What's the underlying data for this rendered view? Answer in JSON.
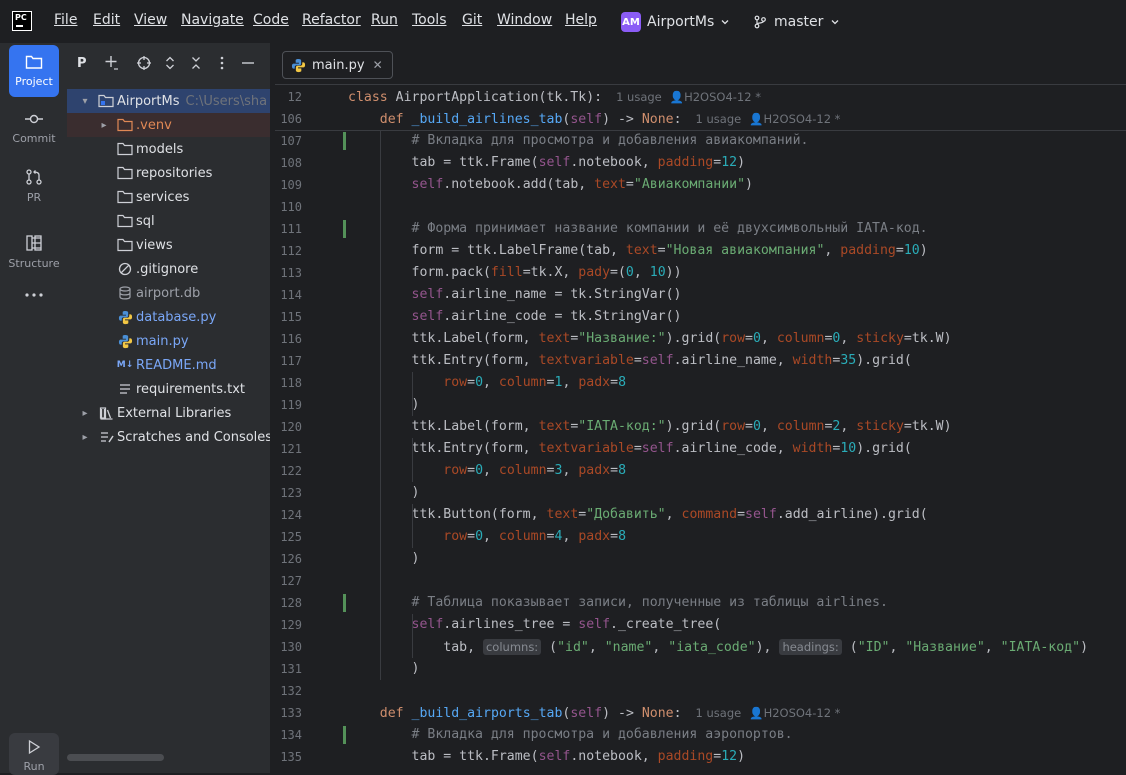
{
  "menubar": {
    "logo_text": "PC",
    "items": [
      "File",
      "Edit",
      "View",
      "Navigate",
      "Code",
      "Refactor",
      "Run",
      "Tools",
      "Git",
      "Window",
      "Help"
    ],
    "project_initials": "AM",
    "project_name": "AirportMs",
    "branch": "master",
    "colors": {
      "project_avatar": "#8b5cf6",
      "accent": "#3574f0"
    }
  },
  "toolwindows": [
    {
      "label": "Project",
      "icon": "folder-icon",
      "active": true
    },
    {
      "label": "Commit",
      "icon": "commit-icon",
      "active": false
    },
    {
      "label": "PR",
      "icon": "pull-request-icon",
      "active": false
    },
    {
      "label": "Structure",
      "icon": "structure-icon",
      "active": false
    },
    {
      "label": "",
      "icon": "more-icon",
      "active": false
    },
    {
      "label": "Run",
      "icon": "run-icon",
      "active": false
    }
  ],
  "project_panel": {
    "title": "P",
    "tree": [
      {
        "name": "AirportMs",
        "hint": "C:\\Users\\sha",
        "kind": "root-folder",
        "expanded": true,
        "depth": 0,
        "selected": true
      },
      {
        "name": ".venv",
        "kind": "excluded-folder",
        "expanded": false,
        "depth": 1
      },
      {
        "name": "models",
        "kind": "folder",
        "depth": 1
      },
      {
        "name": "repositories",
        "kind": "folder",
        "depth": 1
      },
      {
        "name": "services",
        "kind": "folder",
        "depth": 1
      },
      {
        "name": "sql",
        "kind": "folder",
        "depth": 1
      },
      {
        "name": "views",
        "kind": "folder",
        "depth": 1
      },
      {
        "name": ".gitignore",
        "kind": "ignore-file",
        "depth": 1
      },
      {
        "name": "airport.db",
        "kind": "db-file",
        "depth": 1
      },
      {
        "name": "database.py",
        "kind": "python-file",
        "depth": 1
      },
      {
        "name": "main.py",
        "kind": "python-file",
        "depth": 1
      },
      {
        "name": "README.md",
        "kind": "markdown-file",
        "depth": 1
      },
      {
        "name": "requirements.txt",
        "kind": "text-file",
        "depth": 1
      },
      {
        "name": "External Libraries",
        "kind": "libraries",
        "expanded": false,
        "depth": 0
      },
      {
        "name": "Scratches and Consoles",
        "kind": "scratches",
        "expanded": false,
        "depth": 0
      }
    ]
  },
  "editor": {
    "tab_name": "main.py",
    "sticky": [
      {
        "n": "12",
        "code": "class AirportApplication(tk.Tk):",
        "usage": "1 usage",
        "author": "H2OSO4-12 *"
      },
      {
        "n": "106",
        "code": "def _build_airlines_tab(self) -> None:",
        "usage": "1 usage",
        "author": "H2OSO4-12 *"
      }
    ],
    "lines": [
      {
        "n": "107",
        "text": "        # Вкладка для просмотра и добавления авиакомпаний."
      },
      {
        "n": "108",
        "text": "        tab = ttk.Frame(self.notebook, padding=12)"
      },
      {
        "n": "109",
        "text": "        self.notebook.add(tab, text=\"Авиакомпании\")"
      },
      {
        "n": "110",
        "text": ""
      },
      {
        "n": "111",
        "text": "        # Форма принимает название компании и её двухсимвольный IATA-код."
      },
      {
        "n": "112",
        "text": "        form = ttk.LabelFrame(tab, text=\"Новая авиакомпания\", padding=10)"
      },
      {
        "n": "113",
        "text": "        form.pack(fill=tk.X, pady=(0, 10))"
      },
      {
        "n": "114",
        "text": "        self.airline_name = tk.StringVar()"
      },
      {
        "n": "115",
        "text": "        self.airline_code = tk.StringVar()"
      },
      {
        "n": "116",
        "text": "        ttk.Label(form, text=\"Название:\").grid(row=0, column=0, sticky=tk.W)"
      },
      {
        "n": "117",
        "text": "        ttk.Entry(form, textvariable=self.airline_name, width=35).grid("
      },
      {
        "n": "118",
        "text": "            row=0, column=1, padx=8"
      },
      {
        "n": "119",
        "text": "        )"
      },
      {
        "n": "120",
        "text": "        ttk.Label(form, text=\"IATA-код:\").grid(row=0, column=2, sticky=tk.W)"
      },
      {
        "n": "121",
        "text": "        ttk.Entry(form, textvariable=self.airline_code, width=10).grid("
      },
      {
        "n": "122",
        "text": "            row=0, column=3, padx=8"
      },
      {
        "n": "123",
        "text": "        )"
      },
      {
        "n": "124",
        "text": "        ttk.Button(form, text=\"Добавить\", command=self.add_airline).grid("
      },
      {
        "n": "125",
        "text": "            row=0, column=4, padx=8"
      },
      {
        "n": "126",
        "text": "        )"
      },
      {
        "n": "127",
        "text": ""
      },
      {
        "n": "128",
        "text": "        # Таблица показывает записи, полученные из таблицы airlines."
      },
      {
        "n": "129",
        "text": "        self.airlines_tree = self._create_tree("
      },
      {
        "n": "130",
        "text": "            tab, columns: (\"id\", \"name\", \"iata_code\"), headings: (\"ID\", \"Название\", \"IATA-код\")"
      },
      {
        "n": "131",
        "text": "        )"
      },
      {
        "n": "132",
        "text": ""
      },
      {
        "n": "133",
        "text": "    def _build_airports_tab(self) -> None:",
        "usage": "1 usage",
        "author": "H2OSO4-12 *"
      },
      {
        "n": "134",
        "text": "        # Вкладка для просмотра и добавления аэропортов."
      },
      {
        "n": "135",
        "text": "        tab = ttk.Frame(self.notebook, padding=12)"
      }
    ],
    "changed_lines": [
      "107",
      "111",
      "128",
      "134"
    ],
    "colors": {
      "keyword": "#cf8e6d",
      "string": "#6aab73",
      "number": "#2aacb8",
      "comment": "#7a7e85",
      "self": "#94558d",
      "param": "#aa4926",
      "function": "#56a8f5",
      "vcs_added": "#549159"
    }
  }
}
